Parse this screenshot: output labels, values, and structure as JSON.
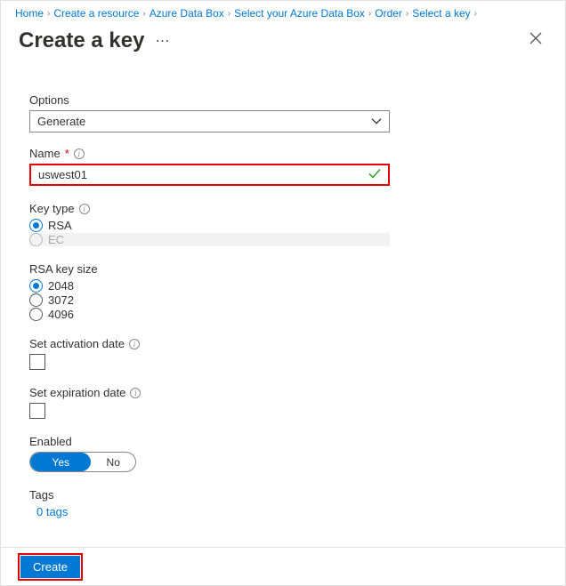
{
  "breadcrumb": [
    "Home",
    "Create a resource",
    "Azure Data Box",
    "Select your Azure Data Box",
    "Order",
    "Select a key"
  ],
  "title": "Create a key",
  "fields": {
    "options": {
      "label": "Options",
      "value": "Generate"
    },
    "name": {
      "label": "Name",
      "value": "uswest01"
    },
    "keyType": {
      "label": "Key type",
      "opts": [
        "RSA",
        "EC"
      ],
      "selected": "RSA"
    },
    "keySize": {
      "label": "RSA key size",
      "opts": [
        "2048",
        "3072",
        "4096"
      ],
      "selected": "2048"
    },
    "activation": {
      "label": "Set activation date"
    },
    "expiration": {
      "label": "Set expiration date"
    },
    "enabled": {
      "label": "Enabled",
      "yes": "Yes",
      "no": "No"
    },
    "tags": {
      "label": "Tags",
      "link": "0 tags"
    }
  },
  "buttons": {
    "create": "Create"
  }
}
